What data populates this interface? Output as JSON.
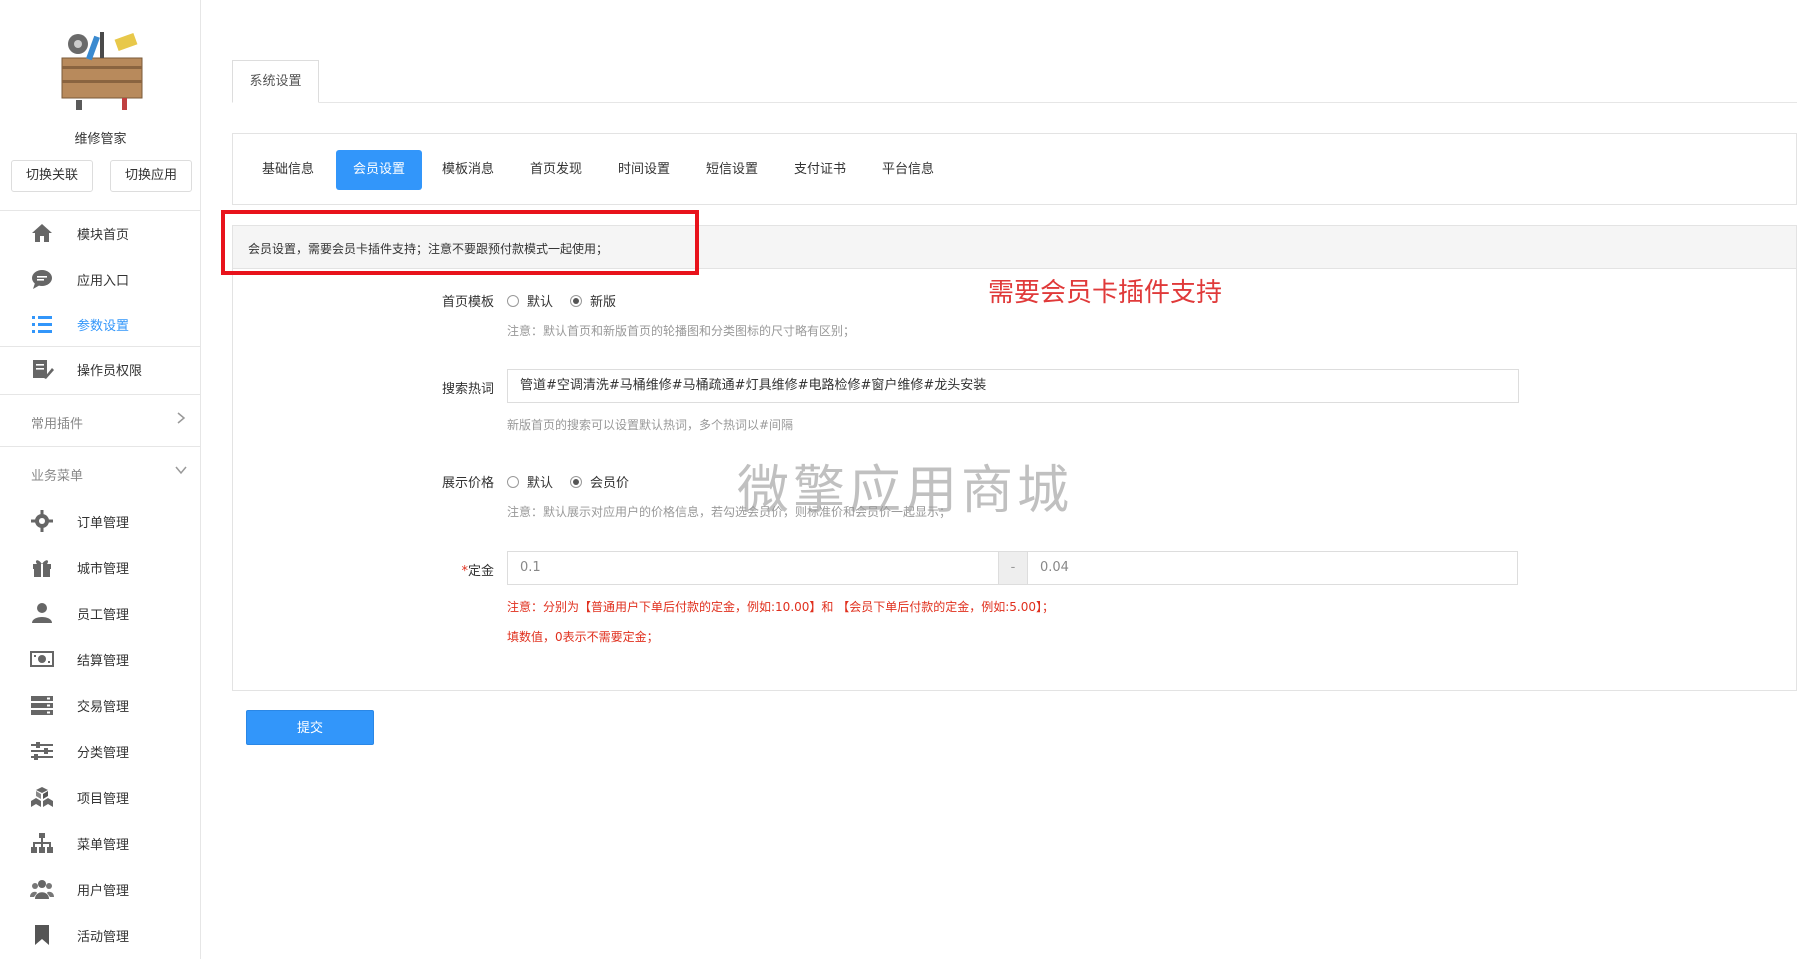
{
  "sidebar": {
    "app_name": "维修管家",
    "switch_buttons": [
      "切换关联",
      "切换应用"
    ],
    "nav_top": [
      {
        "label": "模块首页",
        "icon": "home-icon"
      },
      {
        "label": "应用入口",
        "icon": "chat-icon"
      },
      {
        "label": "参数设置",
        "icon": "list-icon",
        "active": true
      },
      {
        "label": "操作员权限",
        "icon": "edit-doc-icon"
      }
    ],
    "group_plugins": "常用插件",
    "group_business": "业务菜单",
    "nav_business": [
      {
        "label": "订单管理",
        "icon": "gear-icon"
      },
      {
        "label": "城市管理",
        "icon": "gift-icon"
      },
      {
        "label": "员工管理",
        "icon": "user-icon"
      },
      {
        "label": "结算管理",
        "icon": "money-icon"
      },
      {
        "label": "交易管理",
        "icon": "server-icon"
      },
      {
        "label": "分类管理",
        "icon": "sliders-icon"
      },
      {
        "label": "项目管理",
        "icon": "cubes-icon"
      },
      {
        "label": "菜单管理",
        "icon": "sitemap-icon"
      },
      {
        "label": "用户管理",
        "icon": "users-icon"
      },
      {
        "label": "活动管理",
        "icon": "bookmark-icon"
      }
    ]
  },
  "main": {
    "top_tab": "系统设置",
    "sub_tabs": [
      {
        "label": "基础信息"
      },
      {
        "label": "会员设置",
        "active": true
      },
      {
        "label": "模板消息"
      },
      {
        "label": "首页发现"
      },
      {
        "label": "时间设置"
      },
      {
        "label": "短信设置"
      },
      {
        "label": "支付证书"
      },
      {
        "label": "平台信息"
      }
    ],
    "panel_title": "会员设置，需要会员卡插件支持；注意不要跟预付款模式一起使用；",
    "annotation": "需要会员卡插件支持",
    "watermark": "微擎应用商城",
    "form": {
      "home_template": {
        "label": "首页模板",
        "options": [
          "默认",
          "新版"
        ],
        "selected": "新版",
        "hint": "注意：默认首页和新版首页的轮播图和分类图标的尺寸略有区别；"
      },
      "search_hot": {
        "label": "搜索热词",
        "value": "管道#空调清洗#马桶维修#马桶疏通#灯具维修#电路检修#窗户维修#龙头安装",
        "hint": "新版首页的搜索可以设置默认热词，多个热词以#间隔"
      },
      "show_price": {
        "label": "展示价格",
        "options": [
          "默认",
          "会员价"
        ],
        "selected": "默认",
        "hint": "注意：默认展示对应用户的价格信息，若勾选会员价，则标准价和会员价一起显示；"
      },
      "deposit": {
        "label_star": "*",
        "label": "定金",
        "value_normal": "0.1",
        "separator": "-",
        "value_member": "0.04",
        "hint_line1": "注意：分别为【普通用户下单后付款的定金，例如:10.00】和 【会员下单后付款的定金，例如:5.00】；",
        "hint_line2": "填数值，0表示不需要定金；"
      }
    },
    "submit_label": "提交"
  },
  "colors": {
    "accent": "#3296fa",
    "warning_red": "#e0301e",
    "highlight_box": "#e8121b"
  }
}
